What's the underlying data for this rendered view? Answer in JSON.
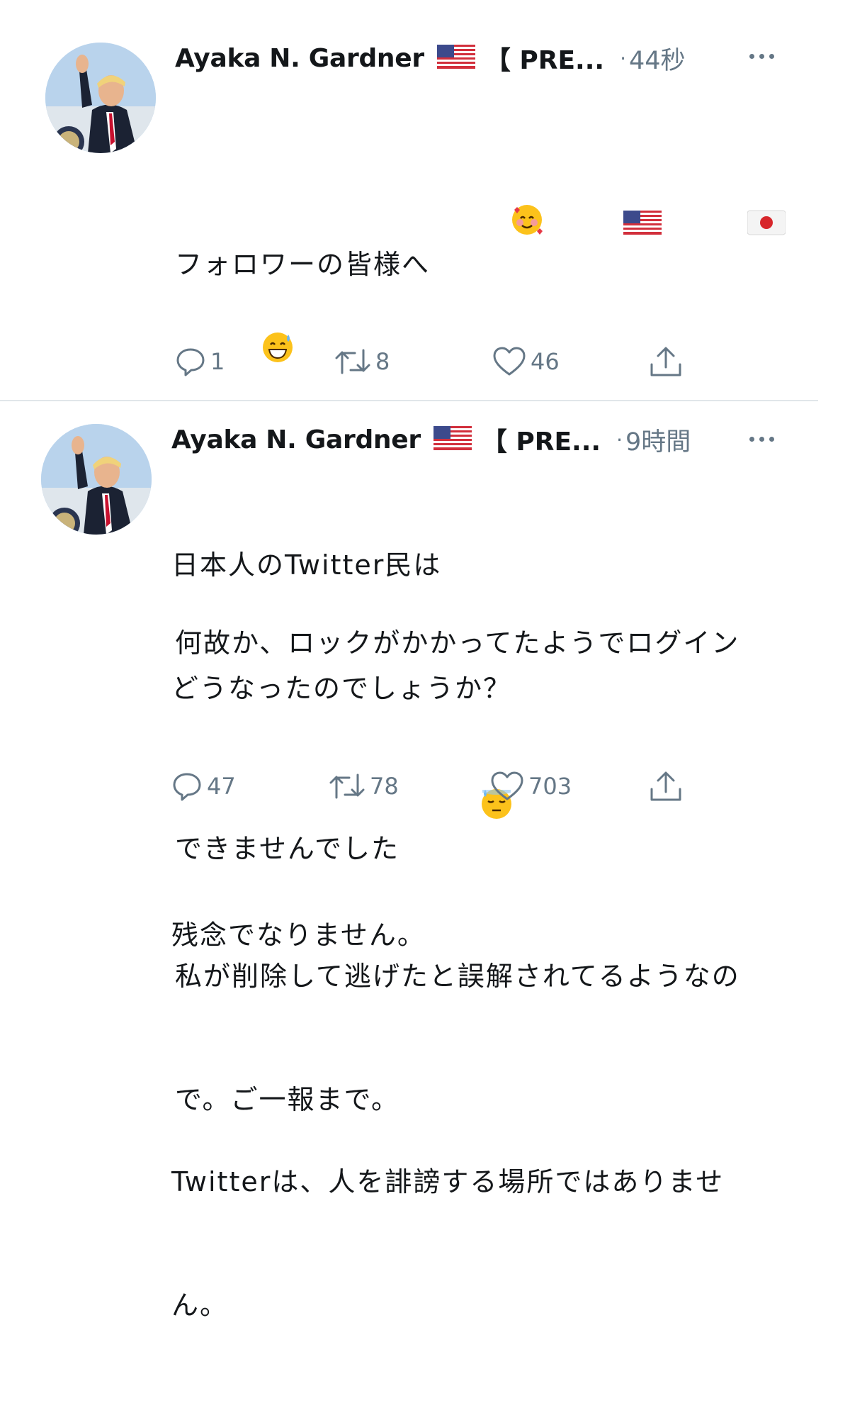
{
  "tweets": [
    {
      "author_name": "Ayaka N. Gardner",
      "flag_icon": "us-flag-icon",
      "name_suffix": "【 PRE...",
      "time": "44秒",
      "lines": [
        "フォロワーの皆様へ",
        "",
        "何故か、ロックがかかってたようでログイン",
        "できませんでした",
        "私が削除して逃げたと誤解されてるようなの",
        "で。ご一報まで。"
      ],
      "emojis_line1": [
        "smiling-face-with-hearts-icon",
        "us-flag-icon",
        "japan-flag-icon",
        "grinning-sweat-icon"
      ],
      "emoji_line4": "downcast-sweat-icon",
      "replies": "1",
      "retweets": "8",
      "likes": "46"
    },
    {
      "author_name": "Ayaka N. Gardner",
      "flag_icon": "us-flag-icon",
      "name_suffix": "【 PRE...",
      "time": "9時間",
      "lines": [
        "日本人のTwitter民は",
        "どうなったのでしょうか？",
        "",
        "残念でなりません。",
        "",
        "Twitterは、人を誹謗する場所ではありませ",
        "ん。"
      ],
      "replies": "47",
      "retweets": "78",
      "likes": "703"
    }
  ],
  "colors": {
    "text": "#14171a",
    "muted": "#657786",
    "divider": "#e1e6ea"
  }
}
